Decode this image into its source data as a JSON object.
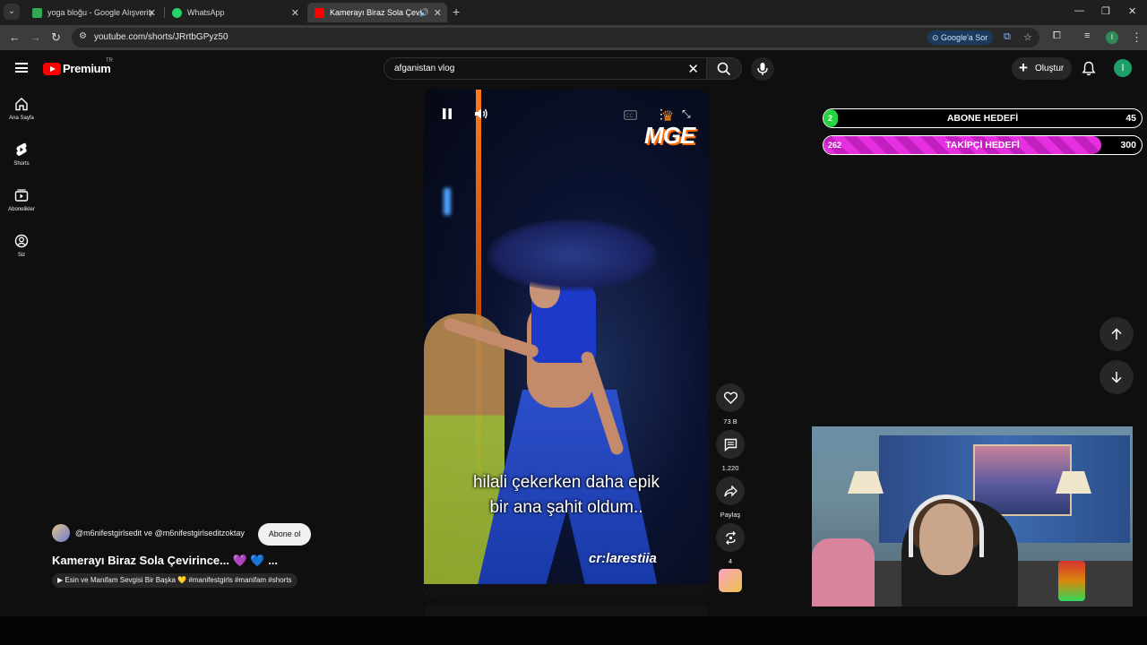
{
  "browser": {
    "tabs": [
      {
        "label": "yoga bloğu - Google Alışveriş",
        "favicon_color": "#34a853"
      },
      {
        "label": "WhatsApp",
        "favicon_color": "#25d366"
      },
      {
        "label": "Kamerayı Biraz Sola Çevirince...",
        "favicon_color": "#ff0000"
      }
    ],
    "url": "youtube.com/shorts/JRrtbGPyz50",
    "google_ask_label": "Google'a Sor",
    "profile_initial": "I"
  },
  "youtube": {
    "logo_text": "Premium",
    "region": "TR",
    "search_query": "afganistan vlog",
    "create_label": "Oluştur",
    "avatar_initial": "I",
    "sidebar": [
      {
        "label": "Ana Sayfa",
        "icon": "home-icon"
      },
      {
        "label": "Shorts",
        "icon": "shorts-icon"
      },
      {
        "label": "Abonelikler",
        "icon": "subscriptions-icon"
      },
      {
        "label": "Siz",
        "icon": "you-icon"
      }
    ]
  },
  "short": {
    "overlay_brand": "MGE",
    "subtitle_line1": "hilali çekerken daha epik",
    "subtitle_line2": "bir ana şahit oldum..",
    "credit": "cr:larestiia",
    "channel_names": "@m6nifestgirlsedit ve @m6nifestgirlseditzoktay",
    "subscribe_label": "Abone ol",
    "title": "Kamerayı Biraz Sola Çevirince... 💜 💙 ...",
    "hashtag_chip": "▶ Esin ve Manifam Sevgisi Bir Başka 💛 #manifestgirls #manifam #shorts",
    "actions": {
      "likes": "73 B",
      "comments": "1.220",
      "share": "Paylaş",
      "remix": "4"
    }
  },
  "stream_overlay": {
    "goals": [
      {
        "label": "ABONE HEDEFİ",
        "current": "2",
        "target": "45",
        "progress": 0.044,
        "color": "#25d441"
      },
      {
        "label": "TAKİPÇİ HEDEFİ",
        "current": "262",
        "target": "300",
        "progress": 0.873,
        "color": "#e52fe0"
      }
    ]
  }
}
